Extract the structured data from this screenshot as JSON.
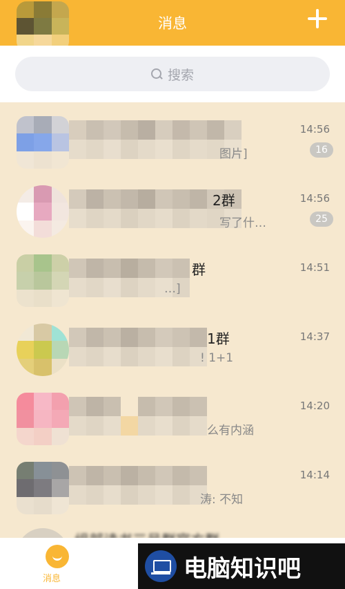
{
  "header": {
    "title": "消息"
  },
  "search": {
    "placeholder": "搜索"
  },
  "chats": [
    {
      "name_tail": "",
      "preview_tail": "图片]",
      "time": "14:56",
      "badge": "16"
    },
    {
      "name_tail": "2群",
      "preview_tail": "写了什…",
      "time": "14:56",
      "badge": "25"
    },
    {
      "name_tail": "群",
      "preview_tail": "…]",
      "time": "14:51",
      "badge": ""
    },
    {
      "name_tail": "1群",
      "preview_tail": "!  1+1",
      "time": "14:37",
      "badge": ""
    },
    {
      "name_tail": "",
      "preview_tail": "么有内涵",
      "time": "14:20",
      "badge": ""
    },
    {
      "name_tail": "",
      "preview_tail": "涛: 不知",
      "time": "14:14",
      "badge": ""
    }
  ],
  "partial_row": {
    "text": "组部读书三号群官方群"
  },
  "tabbar": {
    "active_label": "消息"
  },
  "watermark": {
    "text": "电脑知识吧"
  },
  "colors": {
    "accent": "#f9b634",
    "list_bg": "#f6e8cf"
  }
}
